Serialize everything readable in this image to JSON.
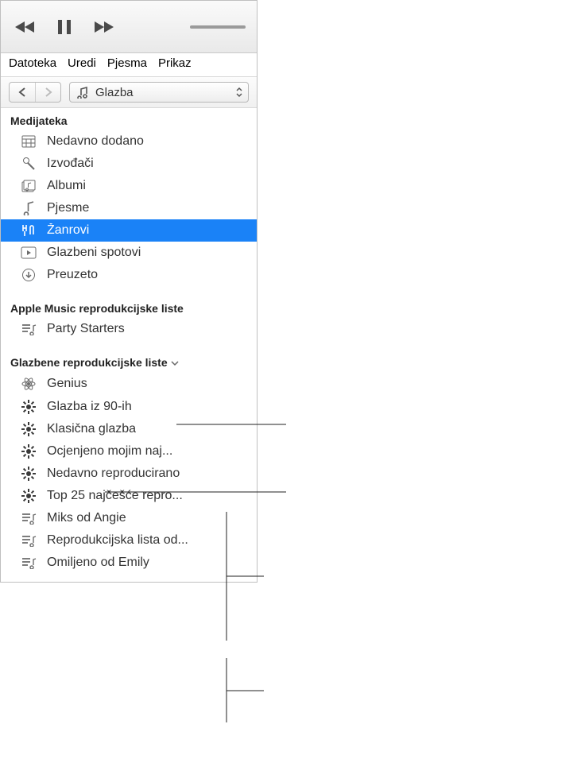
{
  "menu": {
    "file": "Datoteka",
    "edit": "Uredi",
    "song": "Pjesma",
    "view": "Prikaz"
  },
  "category": {
    "label": "Glazba"
  },
  "sections": {
    "library_header": "Medijateka",
    "apple_header": "Apple Music reprodukcijske liste",
    "playlists_header": "Glazbene reprodukcijske liste"
  },
  "library": {
    "recently_added": "Nedavno dodano",
    "artists": "Izvođači",
    "albums": "Albumi",
    "songs": "Pjesme",
    "genres": "Žanrovi",
    "music_videos": "Glazbeni spotovi",
    "downloaded": "Preuzeto"
  },
  "apple_playlists": {
    "party_starters": "Party Starters"
  },
  "playlists": {
    "genius": "Genius",
    "nineties": "Glazba iz 90-ih",
    "classical": "Klasična glazba",
    "top_rated": "Ocjenjeno mojim naj...",
    "recently_played": "Nedavno reproducirano",
    "top25": "Top 25 najčešće repro...",
    "angie": "Miks od Angie",
    "list_from": "Reprodukcijska lista od...",
    "emily": "Omiljeno od Emily"
  }
}
